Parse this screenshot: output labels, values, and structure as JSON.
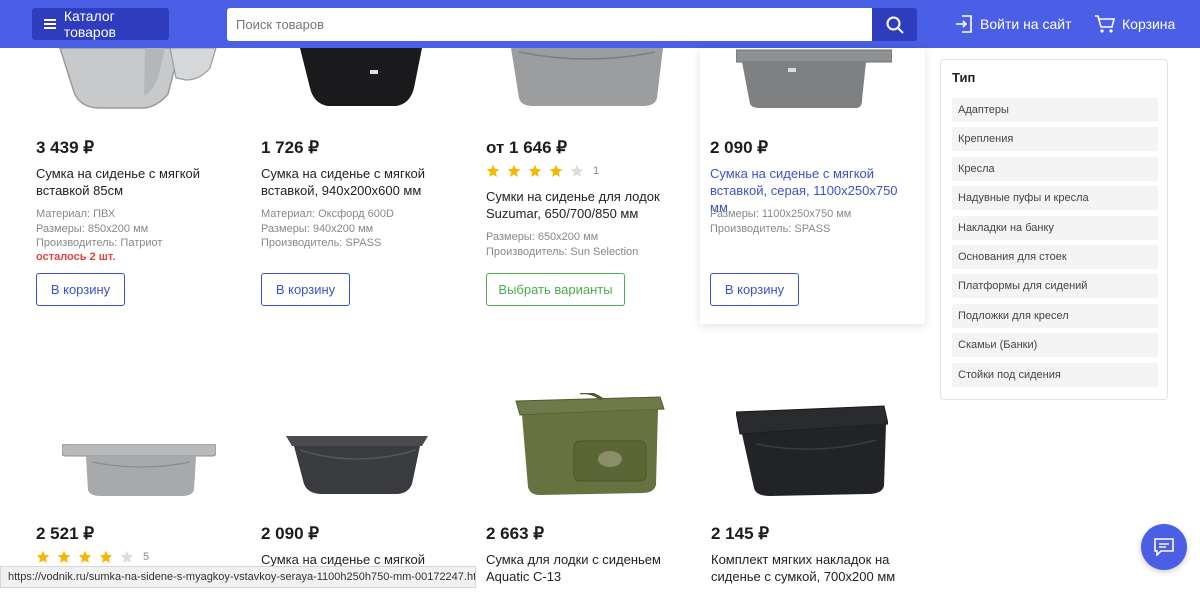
{
  "header": {
    "catalog_label": "Каталог товаров",
    "search_placeholder": "Поиск товаров",
    "login_label": "Войти на сайт",
    "cart_label": "Корзина",
    "bg_color": "#4a5ee6",
    "accent_color": "#2e3dbd"
  },
  "products": [
    {
      "price": "3 439 ₽",
      "title": "Сумка на сиденье с мягкой вставкой 85см",
      "props": [
        "Материал: ПВХ",
        "Размеры: 850x200 мм",
        "Производитель: Патриот"
      ],
      "stock": "осталось 2 шт.",
      "button": "В корзину"
    },
    {
      "price": "1 726 ₽",
      "title": "Сумка на сиденье с мягкой вставкой, 940x200x600 мм",
      "props": [
        "Материал: Оксфорд 600D",
        "Размеры: 940x200 мм",
        "Производитель: SPASS"
      ],
      "button": "В корзину"
    },
    {
      "price": "от 1 646 ₽",
      "rating": 4,
      "rating_count": "1",
      "title": "Сумки на сиденье для лодок Suzumar, 650/700/850 мм",
      "props": [
        "Размеры: 650x200 мм",
        "Производитель: Sun Selection"
      ],
      "button": "Выбрать варианты"
    },
    {
      "price": "2 090 ₽",
      "title": "Сумка на сиденье с мягкой вставкой, серая, 1100x250x750 мм",
      "props": [
        "Размеры: 1100x250x750 мм",
        "Производитель: SPASS"
      ],
      "button": "В корзину"
    },
    {
      "price": "2 521 ₽",
      "rating": 4,
      "rating_count": "5"
    },
    {
      "price": "2 090 ₽",
      "title": "Сумка на сиденье с мягкой"
    },
    {
      "price": "2 663 ₽",
      "title": "Сумка для лодки с сиденьем Aquatic С-13"
    },
    {
      "price": "2 145 ₽",
      "title": "Комплект мягких накладок на сиденье с сумкой, 700x200 мм"
    }
  ],
  "filter": {
    "title": "Тип",
    "items": [
      "Адаптеры",
      "Крепления",
      "Кресла",
      "Надувные пуфы и кресла",
      "Накладки на банку",
      "Основания для стоек",
      "Платформы для сидений",
      "Подложки для кресел",
      "Скамьи (Банки)",
      "Стойки под сидения"
    ]
  },
  "statusbar": {
    "url": "https://vodnik.ru/sumka-na-sidene-s-myagkoy-vstavkoy-seraya-1100h250h750-mm-00172247.html"
  },
  "icons": {
    "menu": "hamburger-icon",
    "search": "search-icon",
    "login": "login-icon",
    "cart": "cart-icon",
    "chat": "chat-icon",
    "star": "star-icon"
  },
  "colors": {
    "link": "#3e51c6",
    "stock_warning": "#e0443c",
    "variants_button": "#4cae4c",
    "star_filled": "#f5b800",
    "star_empty": "#dddddd"
  }
}
